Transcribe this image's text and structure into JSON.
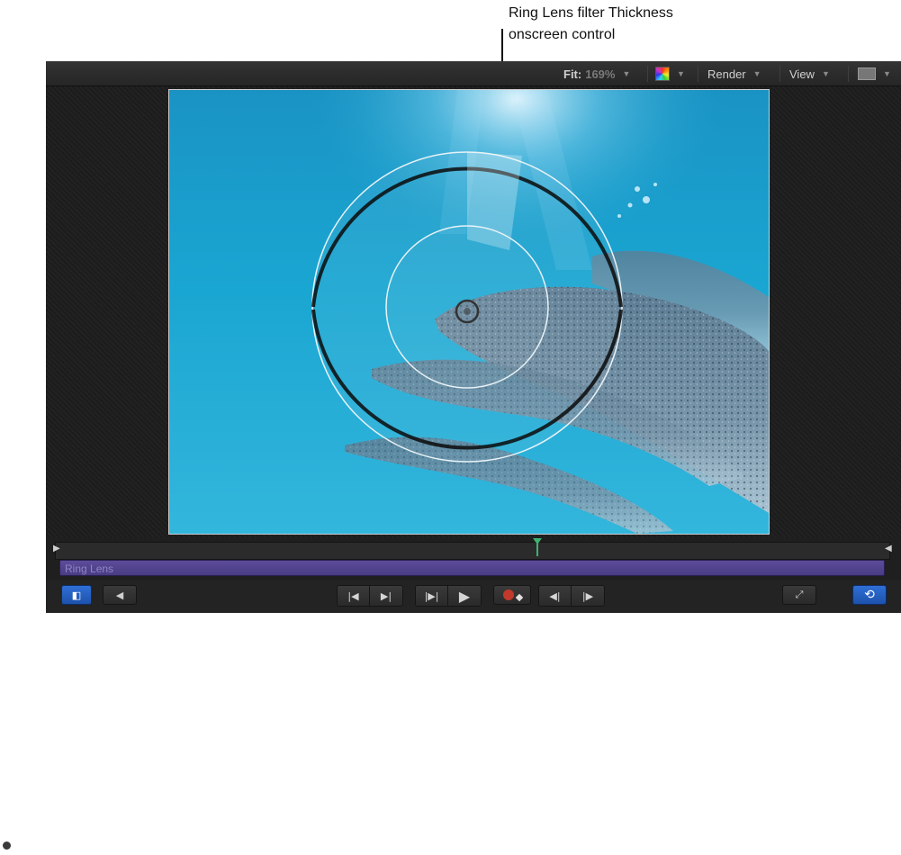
{
  "callout": {
    "line1": "Ring Lens filter Thickness",
    "line2": "onscreen control"
  },
  "toolbar": {
    "fit_label": "Fit:",
    "fit_value": "169%",
    "color_icon": "color-channels-icon",
    "render_label": "Render",
    "view_label": "View",
    "layout_icon": "layout-icon"
  },
  "canvas": {
    "image_description_icon": "dolphins-underwater-image",
    "ring_lens_icon": "ring-lens-onscreen-control"
  },
  "timeline": {
    "in_marker_icon": "in-point-marker-icon",
    "out_marker_icon": "out-point-marker-icon",
    "playhead_icon": "playhead-icon",
    "effect_bar_label": "Ring Lens"
  },
  "transport": {
    "play_range_icon": "play-range-icon",
    "audio_icon": "speaker-icon",
    "go_to_start_icon": "go-to-start-icon",
    "go_to_end_icon": "go-to-end-icon",
    "play_from_start_icon": "play-from-start-icon",
    "play_icon": "play-icon",
    "record_icon": "record-icon",
    "prev_frame_icon": "previous-frame-icon",
    "next_frame_icon": "next-frame-icon",
    "fullscreen_icon": "fullscreen-icon",
    "loop_icon": "loop-icon"
  },
  "colors": {
    "lens_bar": "#4f4290",
    "playhead": "#3cb371",
    "loop_active": "#2f6fd6",
    "record": "#c0392b"
  }
}
